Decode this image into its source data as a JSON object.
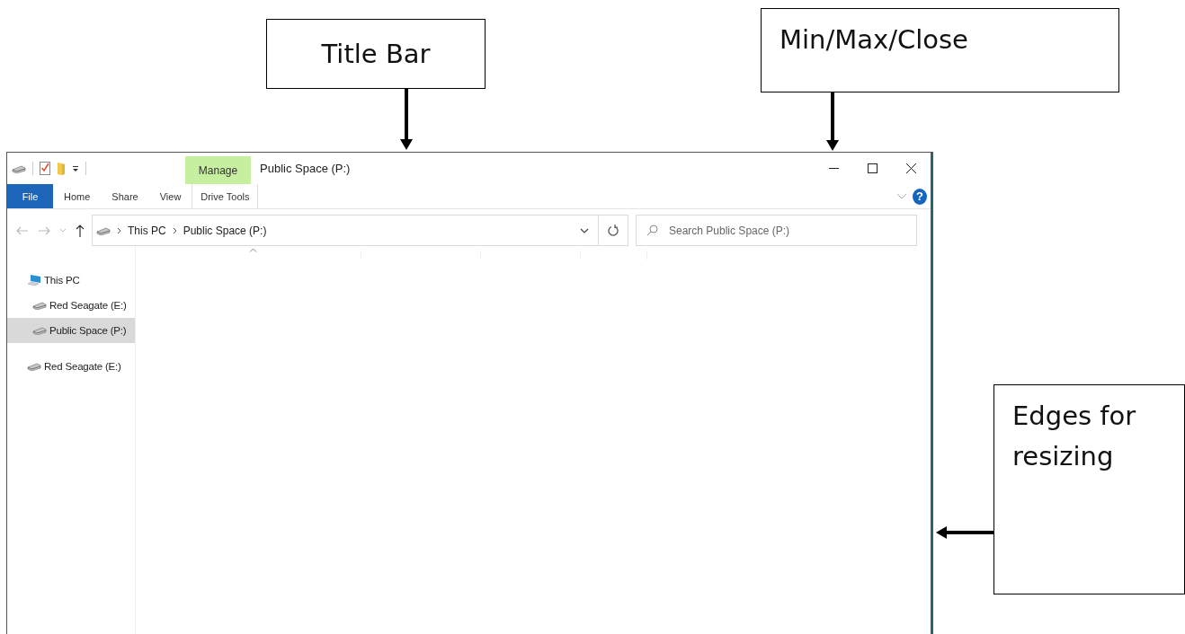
{
  "callouts": [
    {
      "text": "Title Bar"
    },
    {
      "text": "Min/Max/Close"
    },
    {
      "text": "Edges for resizing"
    }
  ],
  "window": {
    "title": "Public Space (P:)",
    "help_icon": "?",
    "contextual_tab": {
      "group": "Manage",
      "label": "Drive Tools",
      "selected": false
    },
    "ribbon_tabs": [
      {
        "label": "File",
        "kind": "file",
        "selected": false
      },
      {
        "label": "Home",
        "kind": "tab",
        "selected": false
      },
      {
        "label": "Share",
        "kind": "tab",
        "selected": false
      },
      {
        "label": "View",
        "kind": "tab",
        "selected": false
      }
    ],
    "address": {
      "crumbs": [
        "This PC",
        "Public Space (P:)"
      ]
    },
    "search": {
      "placeholder": "Search Public Space (P:)"
    },
    "nav_pane": [
      {
        "label": "This PC",
        "kind": "computer",
        "selected": false,
        "children": [
          {
            "label": "Red Seagate (E:)",
            "kind": "drive",
            "selected": false
          },
          {
            "label": "Public Space (P:)",
            "kind": "drive",
            "selected": true
          }
        ]
      },
      {
        "label": "Red Seagate (E:)",
        "kind": "drive",
        "selected": false
      }
    ]
  }
}
